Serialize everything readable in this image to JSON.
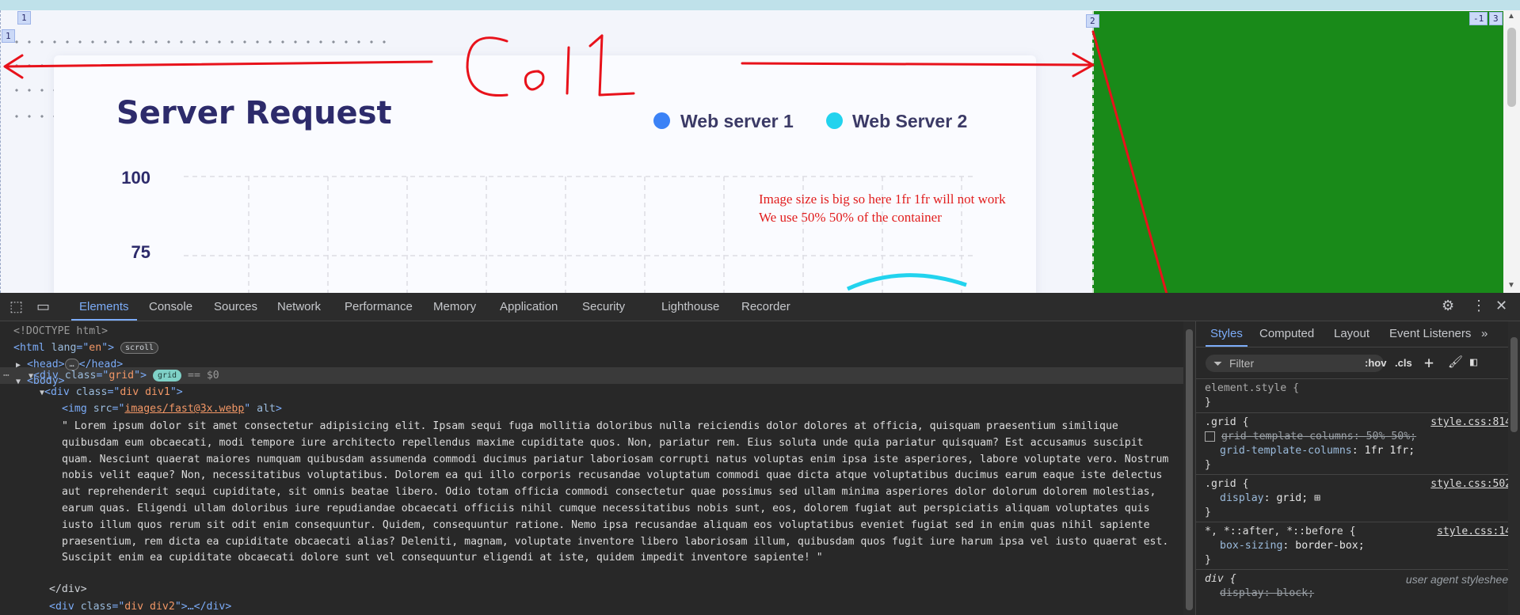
{
  "viewport": {
    "badges": [
      "1",
      "1",
      "2",
      "-1",
      "3"
    ],
    "chart_title": "Server Request",
    "legend": [
      {
        "label": "Web server 1",
        "color": "#3b82f6"
      },
      {
        "label": "Web Server 2",
        "color": "#22d3ee"
      }
    ],
    "yticks": [
      "100",
      "75"
    ],
    "note_line1": "Image size is big so here 1fr 1fr will not work",
    "note_line2": "We use 50% 50% of the container",
    "annotation_text": "Col1",
    "col2_color": "#198a19"
  },
  "devtools": {
    "tabs": [
      "Elements",
      "Console",
      "Sources",
      "Network",
      "Performance",
      "Memory",
      "Application",
      "Security",
      "Lighthouse",
      "Recorder"
    ],
    "active_tab": "Elements",
    "dom": {
      "doctype": "<!DOCTYPE html>",
      "html_open": "<html lang=\"en\">",
      "html_lang": "en",
      "scroll_pill": "scroll",
      "head": "<head>",
      "head_close": "</head>",
      "body_open": "<body>",
      "div_grid": "div",
      "grid_class": "grid",
      "grid_pill": "grid",
      "eq": "== $0",
      "div1_class": "div div1",
      "img_src": "images/fast@3x.webp",
      "lorem": "\" Lorem ipsum dolor sit amet consectetur adipisicing elit. Ipsam sequi fuga mollitia doloribus nulla reiciendis dolor dolores at officia, quisquam praesentium similique quibusdam eum obcaecati, modi tempore iure architecto repellendus maxime cupiditate quos. Non, pariatur rem. Eius soluta unde quia pariatur quisquam? Est accusamus suscipit quam. Nesciunt quaerat maiores numquam quibusdam assumenda commodi ducimus pariatur laboriosam corrupti natus voluptas enim ipsa iste asperiores, labore voluptate vero. Nostrum nobis velit eaque? Non, necessitatibus voluptatibus. Dolorem ea qui illo corporis recusandae voluptatum commodi quae dicta atque voluptatibus ducimus earum eaque iste delectus aut reprehenderit sequi cupiditate, sit omnis beatae libero. Odio totam officia commodi consectetur quae possimus sed ullam minima asperiores dolor dolorum dolorem molestias, earum quas. Eligendi ullam doloribus iure repudiandae obcaecati officiis nihil cumque necessitatibus nobis sunt, eos, dolorem fugiat aut perspiciatis aliquam voluptates quis iusto illum quos rerum sit odit enim consequuntur. Quidem, consequuntur ratione. Nemo ipsa recusandae aliquam eos voluptatibus eveniet fugiat sed in enim quas nihil sapiente praesentium, rem dicta ea cupiditate obcaecati alias? Deleniti, magnam, voluptate inventore libero laboriosam illum, quibusdam quos fugit iure harum ipsa vel iusto quaerat est. Suscipit enim ea cupiditate obcaecati dolore sunt vel consequuntur eligendi at iste, quidem impedit inventore sapiente! \"",
      "div_close": "</div>",
      "div2_class": "div div2"
    },
    "styles_tabs": [
      "Styles",
      "Computed",
      "Layout",
      "Event Listeners"
    ],
    "filter_placeholder": "Filter",
    "hov": ":hov",
    "cls": ".cls",
    "rules": [
      {
        "selector": "element.style {",
        "source": ""
      },
      {
        "selector": ".grid {",
        "source": "style.css:814",
        "decls": [
          {
            "prop": "grid-template-columns",
            "value": "50% 50%;",
            "disabled": true
          },
          {
            "prop": "grid-template-columns",
            "value": "1fr 1fr;",
            "disabled": false
          }
        ]
      },
      {
        "selector": ".grid {",
        "source": "style.css:502",
        "decls": [
          {
            "prop": "display",
            "value": "grid;",
            "disabled": false
          }
        ]
      },
      {
        "selector": "*, *::after, *::before {",
        "source": "style.css:14",
        "decls": [
          {
            "prop": "box-sizing",
            "value": "border-box;",
            "disabled": false
          }
        ]
      },
      {
        "selector": "div {",
        "source": "user agent stylesheet",
        "decls": [
          {
            "prop": "display",
            "value": "block;",
            "disabled": true
          }
        ]
      }
    ]
  }
}
